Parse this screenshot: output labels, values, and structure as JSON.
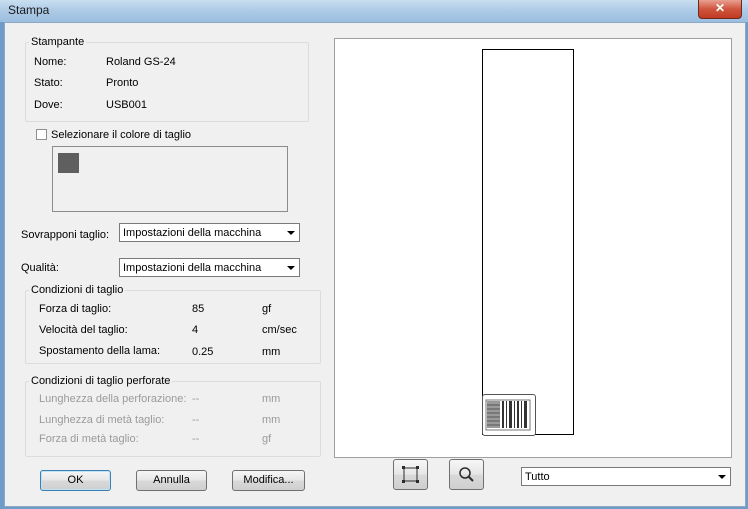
{
  "window": {
    "title": "Stampa",
    "close_glyph": "✕"
  },
  "printer": {
    "group_label": "Stampante",
    "rows": [
      {
        "label": "Nome:",
        "value": "Roland GS-24"
      },
      {
        "label": "Stato:",
        "value": "Pronto"
      },
      {
        "label": "Dove:",
        "value": "USB001"
      }
    ]
  },
  "cut_color": {
    "checkbox_label": "Selezionare il colore di taglio",
    "checked": false,
    "swatch_color": "#5f5f5f"
  },
  "overlap": {
    "label": "Sovrapponi taglio:",
    "value": "Impostazioni della macchina"
  },
  "quality": {
    "label": "Qualità:",
    "value": "Impostazioni della macchina"
  },
  "cut_conditions": {
    "group_label": "Condizioni di taglio",
    "rows": [
      {
        "label": "Forza di taglio:",
        "value": "85",
        "unit": "gf"
      },
      {
        "label": "Velocità del taglio:",
        "value": "4",
        "unit": "cm/sec"
      },
      {
        "label": "Spostamento della lama:",
        "value": "0.25",
        "unit": "mm"
      }
    ]
  },
  "perforated": {
    "group_label": "Condizioni di taglio perforate",
    "rows": [
      {
        "label": "Lunghezza della perforazione:",
        "value": "--",
        "unit": "mm"
      },
      {
        "label": "Lunghezza di metà taglio:",
        "value": "--",
        "unit": "mm"
      },
      {
        "label": "Forza di metà taglio:",
        "value": "--",
        "unit": "gf"
      }
    ]
  },
  "buttons": {
    "ok": "OK",
    "cancel": "Annulla",
    "modify": "Modifica..."
  },
  "preview": {
    "fit_icon": "fit-page-icon",
    "zoom_icon": "magnifier-icon",
    "range_value": "Tutto"
  }
}
